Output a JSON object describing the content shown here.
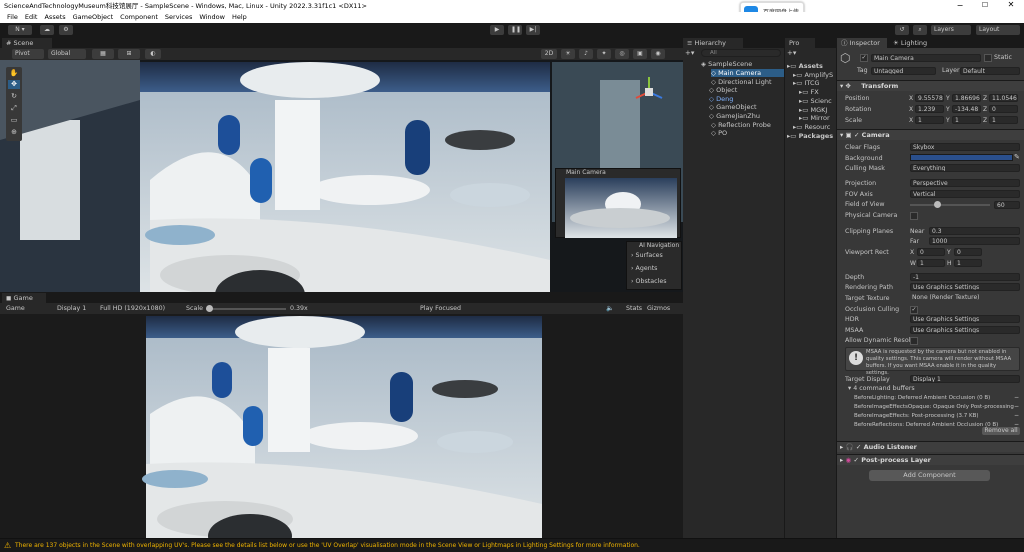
{
  "window": {
    "title": "ScienceAndTechnologyMuseum科技馆展厅 - SampleScene - Windows, Mac, Linux - Unity 2022.3.31f1c1 <DX11>"
  },
  "menu": [
    "File",
    "Edit",
    "Assets",
    "GameObject",
    "Component",
    "Services",
    "Window",
    "Help"
  ],
  "overlay_badge": "百度网盘上传",
  "toolbar": {
    "account": "N ▾",
    "layers": "Layers",
    "layout": "Layout"
  },
  "scene": {
    "tab": "Scene",
    "pivot": "Pivot",
    "global": "Global",
    "mode_2d": "2D",
    "preview_title": "Main Camera",
    "ai_nav": "AI Navigation",
    "ai_items": [
      "Surfaces",
      "Agents",
      "Obstacles"
    ]
  },
  "game": {
    "tab": "Game",
    "display_mode": "Game",
    "display": "Display 1",
    "resolution": "Full HD (1920x1080)",
    "scale_label": "Scale",
    "scale_value": "0.39x",
    "play_mode": "Play Focused",
    "stats": "Stats",
    "gizmos": "Gizmos"
  },
  "hierarchy": {
    "tab": "Hierarchy",
    "search": "All",
    "scene": "SampleScene",
    "items": [
      "Main Camera",
      "Directional Light",
      "Object",
      "Deng",
      "GameObject",
      "GameJianZhu",
      "Reflection Probe",
      "PO"
    ]
  },
  "project": {
    "tab": "Pro",
    "items": [
      "Assets",
      "AmplifyS",
      "ITCG",
      "FX",
      "Scienc",
      "MGKJ",
      "Mirror",
      "Resourc",
      "Packages"
    ]
  },
  "inspector": {
    "tab": "Inspector",
    "lighting_tab": "Lighting",
    "object_name": "Main Camera",
    "static": "Static",
    "tag_label": "Tag",
    "tag_value": "Untagged",
    "layer_label": "Layer",
    "layer_value": "Default",
    "transform": {
      "title": "Transform",
      "position_label": "Position",
      "position": {
        "x": "9.55578",
        "y": "1.86696",
        "z": "11.0546"
      },
      "rotation_label": "Rotation",
      "rotation": {
        "x": "1.239",
        "y": "-134.48",
        "z": "0"
      },
      "scale_label": "Scale",
      "scale": {
        "x": "1",
        "y": "1",
        "z": "1"
      }
    },
    "camera": {
      "title": "Camera",
      "clear_flags_label": "Clear Flags",
      "clear_flags": "Skybox",
      "background_label": "Background",
      "culling_mask_label": "Culling Mask",
      "culling_mask": "Everything",
      "projection_label": "Projection",
      "projection": "Perspective",
      "fov_axis_label": "FOV Axis",
      "fov_axis": "Vertical",
      "fov_label": "Field of View",
      "fov": "60",
      "physical_label": "Physical Camera",
      "clipping_label": "Clipping Planes",
      "near_label": "Near",
      "near": "0.3",
      "far_label": "Far",
      "far": "1000",
      "viewport_label": "Viewport Rect",
      "vp_x": "0",
      "vp_y": "0",
      "vp_w": "1",
      "vp_h": "1",
      "depth_label": "Depth",
      "depth": "-1",
      "rendering_path_label": "Rendering Path",
      "rendering_path": "Use Graphics Settings",
      "target_texture_label": "Target Texture",
      "target_texture": "None (Render Texture)",
      "occlusion_label": "Occlusion Culling",
      "hdr_label": "HDR",
      "hdr": "Use Graphics Settings",
      "msaa_label": "MSAA",
      "msaa": "Use Graphics Settings",
      "dynamic_label": "Allow Dynamic Resol",
      "warning": "MSAA is requested by the camera but not enabled in quality settings. This camera will render without MSAA buffers. If you want MSAA enable it in the quality settings.",
      "target_display_label": "Target Display",
      "target_display": "Display 1",
      "cmd_buffers": "4 command buffers",
      "buffers": [
        "BeforeLighting: Deferred Ambient Occlusion (0 B)",
        "BeforeImageEffectsOpaque: Opaque Only Post-processing (0",
        "BeforeImageEffects: Post-processing (3.7 KB)",
        "BeforeReflections: Deferred Ambient Occlusion (0 B)"
      ],
      "remove_all": "Remove all"
    },
    "audio_listener": "Audio Listener",
    "post_process": "Post-process Layer",
    "add_component": "Add Component"
  },
  "status": {
    "message": "There are 137 objects in the Scene with overlapping UV's. Please see the details list below or use the 'UV Overlap' visualisation mode in the Scene View or Lightmaps in Lighting Settings for more information."
  },
  "colors": {
    "accent": "#2c5d87",
    "background_swatch": "#2a4f8c",
    "warning": "#f0b400"
  }
}
